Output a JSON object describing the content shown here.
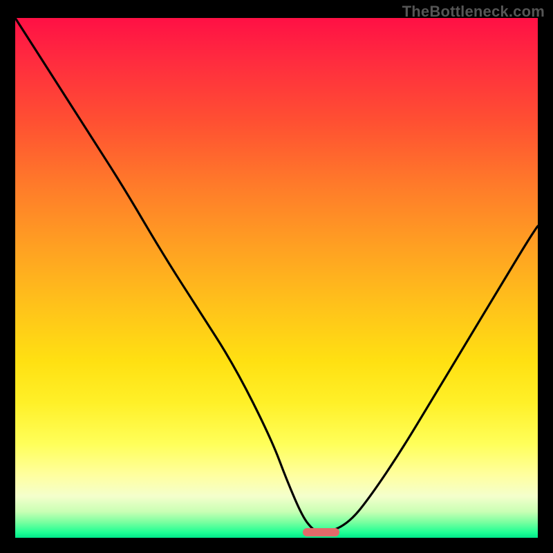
{
  "watermark": "TheBottleneck.com",
  "colors": {
    "frame_bg": "#000000",
    "curve_stroke": "#000000",
    "watermark_text": "#555555",
    "marker": "#e26a6a",
    "gradient_stops": [
      {
        "offset": 0.0,
        "color": "#ff1045"
      },
      {
        "offset": 0.08,
        "color": "#ff2b3f"
      },
      {
        "offset": 0.2,
        "color": "#ff5032"
      },
      {
        "offset": 0.32,
        "color": "#ff7a2a"
      },
      {
        "offset": 0.44,
        "color": "#ffa022"
      },
      {
        "offset": 0.56,
        "color": "#ffc41a"
      },
      {
        "offset": 0.66,
        "color": "#ffe012"
      },
      {
        "offset": 0.74,
        "color": "#fff028"
      },
      {
        "offset": 0.82,
        "color": "#ffff5a"
      },
      {
        "offset": 0.88,
        "color": "#ffffa0"
      },
      {
        "offset": 0.92,
        "color": "#f4ffcc"
      },
      {
        "offset": 0.95,
        "color": "#c8ffb4"
      },
      {
        "offset": 0.97,
        "color": "#7affa0"
      },
      {
        "offset": 0.99,
        "color": "#1eff94"
      },
      {
        "offset": 1.0,
        "color": "#00e68a"
      }
    ]
  },
  "chart_data": {
    "type": "line",
    "title": "",
    "xlabel": "",
    "ylabel": "",
    "xlim": [
      0,
      100
    ],
    "ylim": [
      0,
      100
    ],
    "series": [
      {
        "name": "bottleneck-curve",
        "x": [
          0,
          7,
          14,
          21,
          28,
          35,
          42,
          49,
          52,
          55,
          57,
          58.5,
          60,
          64,
          68,
          74,
          80,
          86,
          92,
          98,
          100
        ],
        "values": [
          100,
          89,
          78,
          67,
          55,
          44,
          33,
          19,
          11,
          4,
          1.5,
          1,
          1,
          3,
          8,
          17,
          27,
          37,
          47,
          57,
          60
        ]
      }
    ],
    "floor_marker": {
      "x_start": 55,
      "x_end": 62,
      "y": 1
    }
  }
}
